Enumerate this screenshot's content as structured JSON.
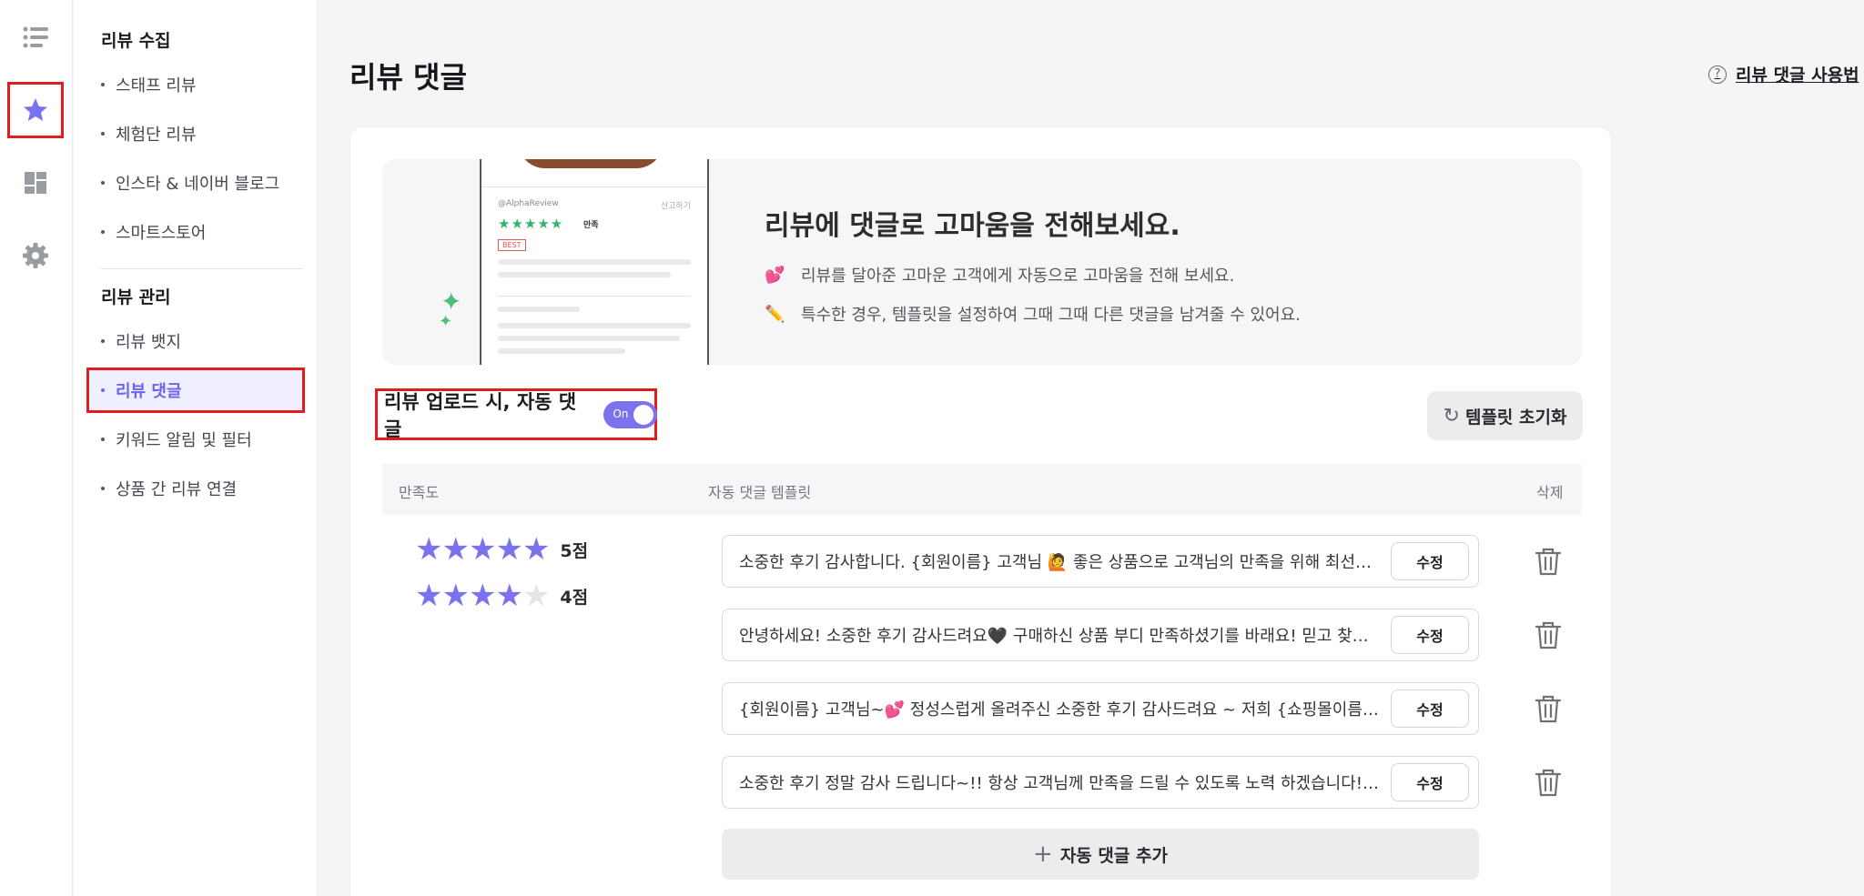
{
  "rail": {
    "items": [
      {
        "icon": "list-icon"
      },
      {
        "icon": "star-icon"
      },
      {
        "icon": "dashboard-icon"
      },
      {
        "icon": "gear-icon"
      }
    ]
  },
  "sidebar": {
    "groups": [
      {
        "title": "리뷰 수집",
        "items": [
          {
            "label": "스태프 리뷰"
          },
          {
            "label": "체험단 리뷰"
          },
          {
            "label": "인스타 & 네이버 블로그"
          },
          {
            "label": "스마트스토어"
          }
        ]
      },
      {
        "title": "리뷰 관리",
        "items": [
          {
            "label": "리뷰 뱃지"
          },
          {
            "label": "리뷰 댓글"
          },
          {
            "label": "키워드 알림 및 필터"
          },
          {
            "label": "상품 간 리뷰 연결"
          }
        ]
      }
    ],
    "active": "리뷰 댓글"
  },
  "header": {
    "title": "리뷰 댓글",
    "help_link": "리뷰 댓글 사용법"
  },
  "banner": {
    "headline": "리뷰에 댓글로 고마움을 전해보세요.",
    "points": [
      {
        "emoji": "💕",
        "text": "리뷰를 달아준 고마운 고객에게 자동으로 고마움을 전해 보세요."
      },
      {
        "emoji": "✏️",
        "text": "특수한 경우, 템플릿을 설정하여 그때 그때 다른 댓글을 남겨줄 수 있어요."
      }
    ],
    "preview": {
      "user": "@AlphaReview",
      "report": "신고하기",
      "satisfaction": "만족",
      "badge": "BEST"
    }
  },
  "auto_reply": {
    "label": "리뷰 업로드 시, 자동 댓글",
    "toggle_text": "On",
    "enabled": true
  },
  "reset_button": "템플릿 초기화",
  "table": {
    "headers": {
      "satisfaction": "만족도",
      "template": "자동 댓글 템플릿",
      "delete": "삭제"
    },
    "ratings": [
      {
        "stars": 5,
        "label": "5점"
      },
      {
        "stars": 4,
        "label": "4점"
      }
    ],
    "templates": [
      {
        "text": "소중한 후기 감사합니다. {회원이름} 고객님 🙋 좋은 상품으로 고객님의 만족을 위해 최선을 다하겠습니다.",
        "edit": "수정"
      },
      {
        "text": "안녕하세요! 소중한 후기 감사드려요🖤 구매하신 상품 부디 만족하셨기를 바래요! 믿고 찾아주셔서 감사합니다.",
        "edit": "수정"
      },
      {
        "text": "{회원이름} 고객님~💕 정성스럽게 올려주신 소중한 후기 감사드려요 ~ 저희 {쇼핑몰이름}은 항상 노력하겠습니다.",
        "edit": "수정"
      },
      {
        "text": "소중한 후기 정말 감사 드립니다~!! 항상 고객님께 만족을 드릴 수 있도록 노력 하겠습니다! 감사합니다.",
        "edit": "수정"
      }
    ]
  },
  "add_button": "자동 댓글 추가",
  "colors": {
    "accent": "#7b73ee",
    "highlight": "#e01e1e",
    "sparkle": "#4cbf7a"
  }
}
